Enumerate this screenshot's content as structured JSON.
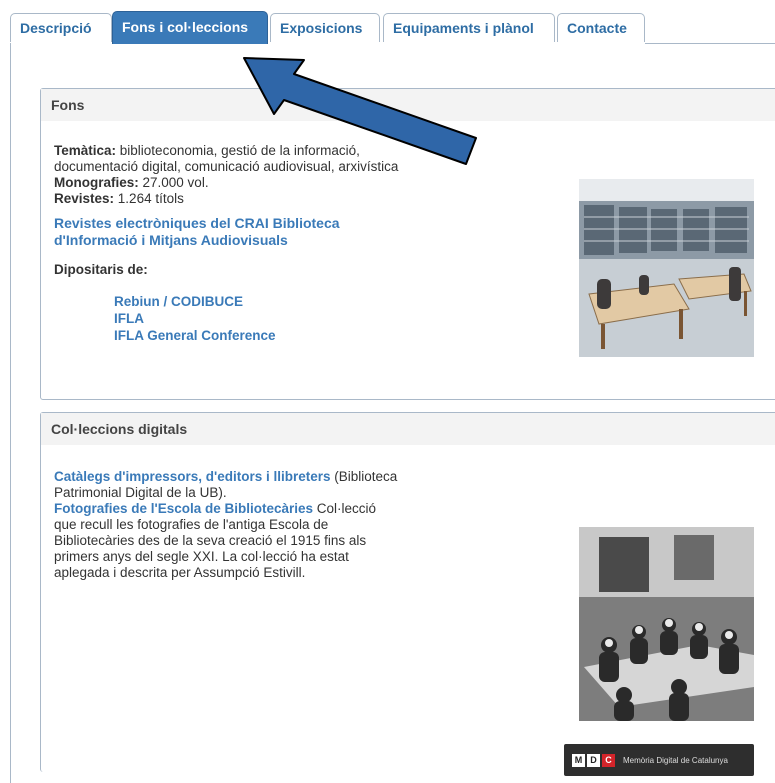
{
  "tabs": [
    {
      "label": "Descripció"
    },
    {
      "label": "Fons i col·leccions"
    },
    {
      "label": "Exposicions"
    },
    {
      "label": "Equipaments i plànol"
    },
    {
      "label": "Contacte"
    }
  ],
  "fons": {
    "title": "Fons",
    "tematica_label": "Temàtica:",
    "tematica_value": " biblioteconomia, gestió de la informació, documentació digital, comunicació audiovisual, arxivística",
    "monografies_label": "Monografies:",
    "monografies_value": " 27.000 vol.",
    "revistes_label": "Revistes:",
    "revistes_value": " 1.264 títols",
    "revistes_link": "Revistes electròniques del CRAI Biblioteca d'Informació i Mitjans Audiovisuals",
    "dipositaris_label": "Dipositaris de:",
    "dipositaris": [
      "Rebiun / CODIBUCE",
      "IFLA",
      "IFLA General Conference"
    ]
  },
  "colleccions": {
    "title": "Col·leccions digitals",
    "link1": "Catàlegs d'impressors, d'editors i llibreters",
    "text1": " (Biblioteca Patrimonial Digital de la UB).",
    "link2": "Fotografies de l'Escola de Bibliotecàries",
    "text2": " Col·lecció que recull les fotografies de l'antiga Escola de Bibliotecàries des de la seva creació el 1915 fins als primers anys del segle XXI. La col·lecció ha estat aplegada i descrita per Assumpció Estivill.",
    "logo_letters": [
      "M",
      "D",
      "C"
    ],
    "logo_text": "Memòria Digital de Catalunya"
  },
  "colors": {
    "accent": "#3a7ab8",
    "arrow_fill": "#2f66a8",
    "border": "#a9b8c8"
  },
  "icons": [
    "arrow-pointer-icon",
    "library-reading-room-photo",
    "historic-school-photo",
    "mdc-logo"
  ]
}
